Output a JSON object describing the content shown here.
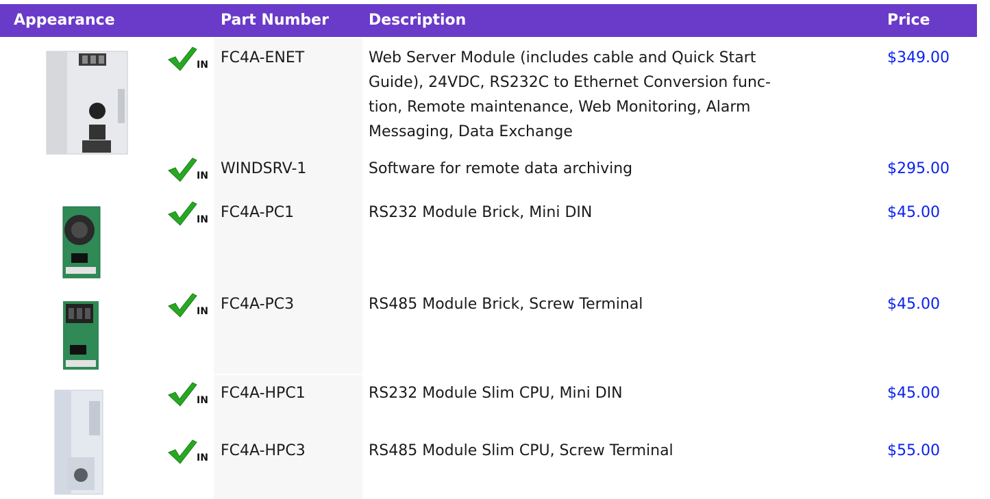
{
  "header": {
    "appearance": "Appearance",
    "part_number": "Part Number",
    "description": "Description",
    "price": "Price"
  },
  "stock_badge": {
    "icon": "checkmark-icon",
    "text": "IN",
    "color": "#27a823"
  },
  "rows": [
    {
      "part": "FC4A-ENET",
      "description_lines": [
        "Web Server Module (includes cable and Quick Start",
        "Guide), 24VDC, RS232C to Ethernet Conversion func-",
        "tion, Remote maintenance, Web Monitoring, Alarm",
        "Messaging, Data Exchange"
      ],
      "price": "$349.00"
    },
    {
      "part": "WINDSRV-1",
      "description_lines": [
        "Software for remote data archiving"
      ],
      "price": "$295.00"
    },
    {
      "part": "FC4A-PC1",
      "description_lines": [
        "RS232 Module Brick, Mini DIN"
      ],
      "price": "$45.00"
    },
    {
      "part": "FC4A-PC3",
      "description_lines": [
        "RS485 Module Brick, Screw Terminal"
      ],
      "price": "$45.00"
    },
    {
      "part": "FC4A-HPC1",
      "description_lines": [
        "RS232 Module Slim CPU, Mini DIN"
      ],
      "price": "$45.00"
    },
    {
      "part": "FC4A-HPC3",
      "description_lines": [
        "RS485 Module Slim CPU, Screw Terminal"
      ],
      "price": "$55.00"
    }
  ],
  "colors": {
    "header_bg": "#6a3ac8",
    "price_link": "#0b22ee"
  }
}
